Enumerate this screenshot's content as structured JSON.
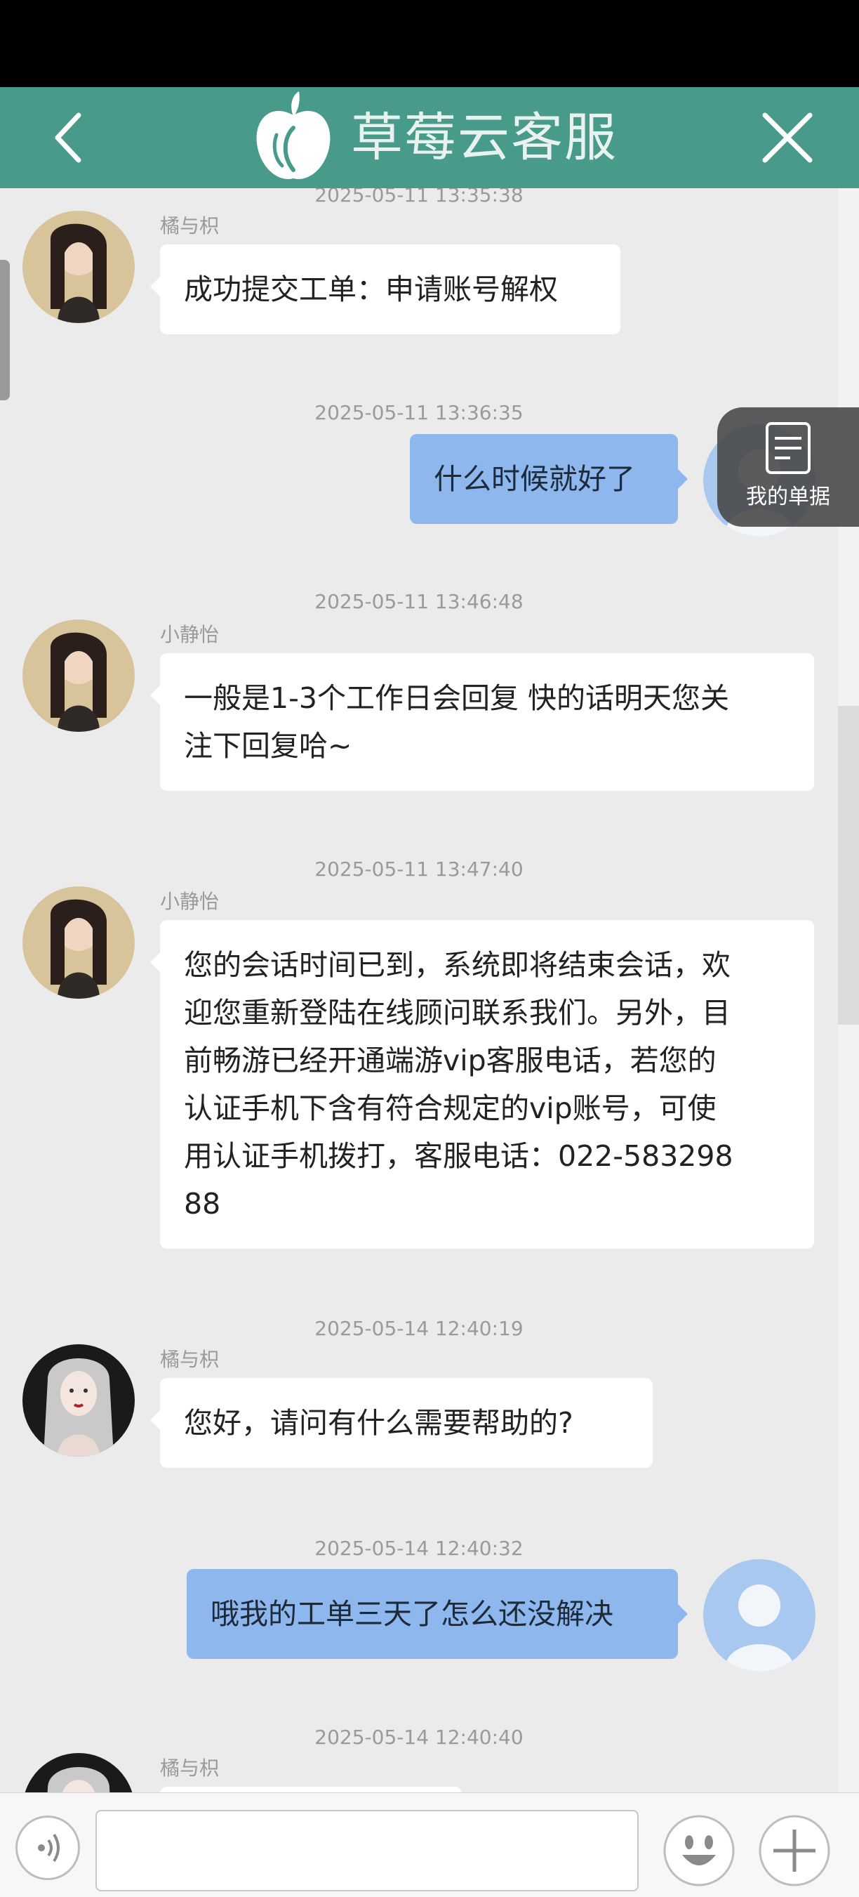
{
  "header": {
    "title": "草莓云客服",
    "colors": {
      "bar": "#489a8a",
      "outgoing_bubble": "#8db7ed",
      "incoming_bubble": "#ffffff",
      "background": "#ebebeb"
    },
    "icons": {
      "back": "chevron-left-icon",
      "logo": "strawberry-logo",
      "close": "close-icon"
    }
  },
  "floating_button": {
    "label": "我的单据",
    "icon": "document-icon"
  },
  "messages": [
    {
      "time": "2025-05-11 13:35:38",
      "sender": "橘与枳",
      "direction": "in",
      "avatar": "agent-photo-avatar",
      "text": "成功提交工单：申请账号解权"
    },
    {
      "time": "2025-05-11 13:36:35",
      "sender": "",
      "direction": "out",
      "avatar": "user-default-avatar",
      "text": "什么时候就好了"
    },
    {
      "time": "2025-05-11 13:46:48",
      "sender": "小静怡",
      "direction": "in",
      "avatar": "agent-photo-avatar",
      "text": "一般是1-3个工作日会回复 快的话明天您关\n注下回复哈~"
    },
    {
      "time": "2025-05-11 13:47:40",
      "sender": "小静怡",
      "direction": "in",
      "avatar": "agent-photo-avatar",
      "text": "您的会话时间已到，系统即将结束会话，欢\n迎您重新登陆在线顾问联系我们。另外，目\n前畅游已经开通端游vip客服电话，若您的\n认证手机下含有符合规定的vip账号，可使\n用认证手机拨打，客服电话：022-583298\n88"
    },
    {
      "time": "2025-05-14 12:40:19",
      "sender": "橘与枳",
      "direction": "in",
      "avatar": "agent-illustrated-avatar",
      "text": "您好，请问有什么需要帮助的?"
    },
    {
      "time": "2025-05-14 12:40:32",
      "sender": "",
      "direction": "out",
      "avatar": "user-default-avatar",
      "text": "哦我的工单三天了怎么还没解决"
    },
    {
      "time": "2025-05-14 12:40:40",
      "sender": "橘与枳",
      "direction": "in",
      "avatar": "agent-illustrated-avatar",
      "text": ""
    }
  ],
  "input_bar": {
    "message_value": "",
    "icons": {
      "voice": "voice-icon",
      "emoji": "emoji-icon",
      "more": "plus-icon"
    }
  }
}
